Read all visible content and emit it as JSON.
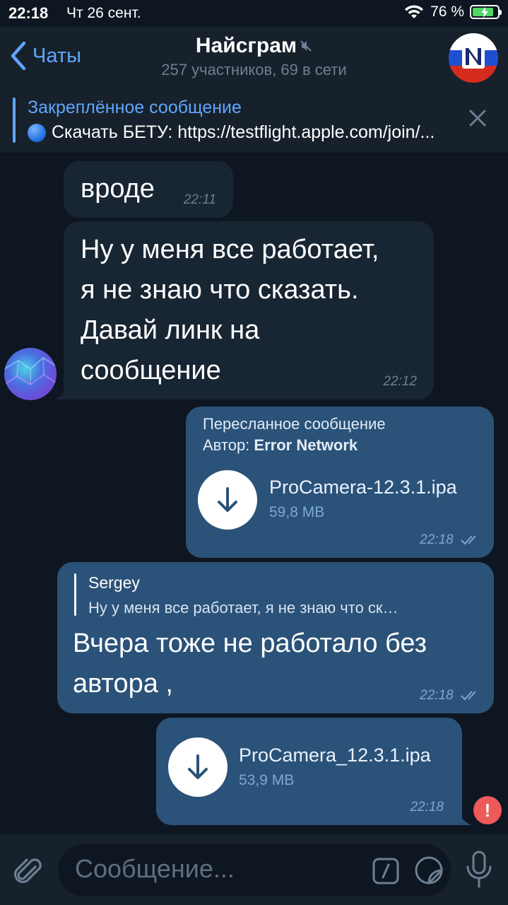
{
  "status_bar": {
    "time": "22:18",
    "date": "Чт 26 сент.",
    "battery": "76 %"
  },
  "header": {
    "back_label": "Чаты",
    "title": "Найсграм",
    "subtitle": "257 участников, 69 в сети"
  },
  "pinned": {
    "label": "Закреплённое сообщение",
    "text": "Скачать БЕТУ: https://testflight.apple.com/join/..."
  },
  "messages": [
    {
      "type": "incoming",
      "text": "вроде",
      "time": "22:11"
    },
    {
      "type": "incoming",
      "lines": [
        "Ну у меня все работает,",
        "я не знаю что сказать.",
        "Давай линк на",
        "сообщение"
      ],
      "time": "22:12"
    },
    {
      "type": "outgoing-file",
      "forwarded_label": "Пересланное сообщение",
      "author_prefix": "Автор: ",
      "author": "Error Network",
      "file_name": "ProCamera-12.3.1.ipa",
      "file_size": "59,8 MB",
      "time": "22:18",
      "status": "read"
    },
    {
      "type": "outgoing-reply",
      "reply_name": "Sergey",
      "reply_text": "Ну у меня все работает, я не знаю что ск…",
      "lines": [
        "Вчера тоже не работало без",
        "автора ,"
      ],
      "time": "22:18",
      "status": "read"
    },
    {
      "type": "outgoing-file",
      "file_name": "ProCamera_12.3.1.ipa",
      "file_size": "53,9 MB",
      "time": "22:18",
      "status": "failed"
    }
  ],
  "input": {
    "placeholder": "Сообщение..."
  },
  "colors": {
    "background": "#0e1621",
    "panel": "#17212b",
    "incoming": "#182533",
    "outgoing": "#2b5278",
    "accent": "#5fa6ff",
    "error": "#ee5a5a"
  },
  "icons": [
    "back-chevron-icon",
    "mute-icon",
    "channel-logo-icon",
    "close-icon",
    "download-icon",
    "double-check-icon",
    "error-icon",
    "paperclip-icon",
    "bot-command-icon",
    "sticker-icon",
    "microphone-icon"
  ]
}
